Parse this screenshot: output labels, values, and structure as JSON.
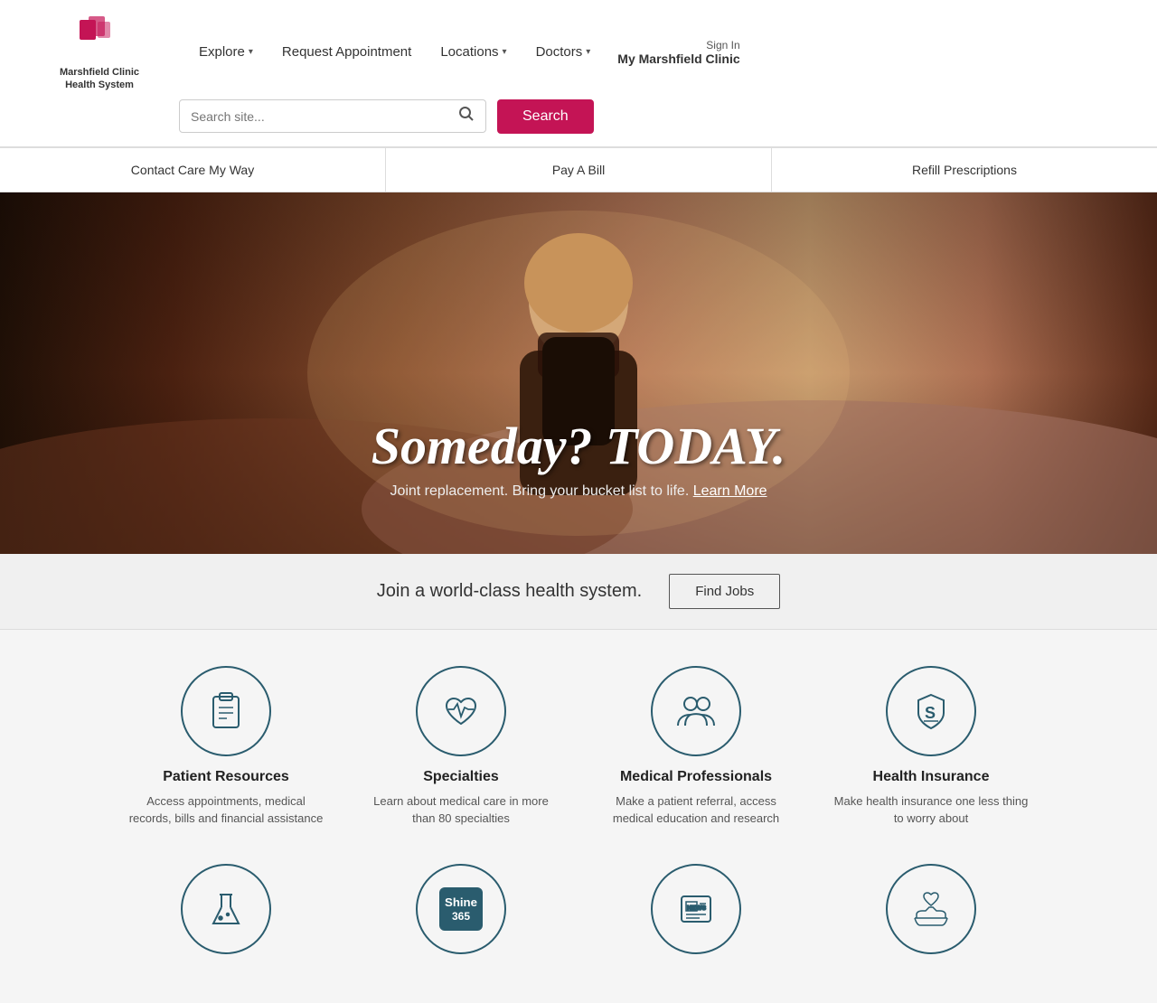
{
  "logo": {
    "text_line1": "Marshfield Clinic",
    "text_line2": "Health System"
  },
  "nav": {
    "items": [
      {
        "label": "Explore",
        "has_dropdown": true
      },
      {
        "label": "Request Appointment",
        "has_dropdown": false
      },
      {
        "label": "Locations",
        "has_dropdown": true
      },
      {
        "label": "Doctors",
        "has_dropdown": true
      }
    ],
    "sign_in_label": "Sign In",
    "my_clinic_label": "My Marshfield Clinic"
  },
  "search": {
    "placeholder": "Search site...",
    "button_label": "Search"
  },
  "utility_bar": {
    "items": [
      {
        "label": "Contact Care My Way"
      },
      {
        "label": "Pay A Bill"
      },
      {
        "label": "Refill Prescriptions"
      }
    ]
  },
  "hero": {
    "headline": "Someday? TODAY.",
    "subtext": "Joint replacement. Bring your bucket list to life.",
    "learn_more_label": "Learn More"
  },
  "hiring": {
    "text": "Join a world-class health system.",
    "button_label": "Find Jobs"
  },
  "cards_row1": [
    {
      "id": "patient-resources",
      "title": "Patient Resources",
      "desc": "Access appointments, medical records, bills and financial assistance",
      "icon_type": "clipboard"
    },
    {
      "id": "specialties",
      "title": "Specialties",
      "desc": "Learn about medical care in more than 80 specialties",
      "icon_type": "heart-pulse"
    },
    {
      "id": "medical-professionals",
      "title": "Medical Professionals",
      "desc": "Make a patient referral, access medical education and research",
      "icon_type": "people"
    },
    {
      "id": "health-insurance",
      "title": "Health Insurance",
      "desc": "Make health insurance one less thing to worry about",
      "icon_type": "shield-s"
    }
  ],
  "cards_row2": [
    {
      "id": "research",
      "title": "",
      "desc": "",
      "icon_type": "flask"
    },
    {
      "id": "shine365",
      "title": "",
      "desc": "",
      "icon_type": "shine365"
    },
    {
      "id": "news",
      "title": "",
      "desc": "",
      "icon_type": "newspaper"
    },
    {
      "id": "giving",
      "title": "",
      "desc": "",
      "icon_type": "hands-heart"
    }
  ]
}
